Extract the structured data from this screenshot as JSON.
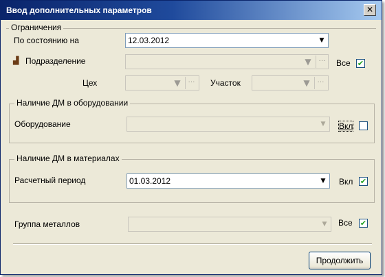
{
  "window": {
    "title": "Ввод дополнительных параметров",
    "close_glyph": "✕"
  },
  "restrictions": {
    "legend": "Ограничения",
    "as_of_label": "По состоянию на",
    "as_of_value": "12.03.2012",
    "department_label": "Подразделение",
    "department_value": "",
    "all_label": "Все",
    "all_checked": true,
    "shop_label": "Цех",
    "shop_value": "",
    "section_label": "Участок",
    "section_value": ""
  },
  "equipment_group": {
    "legend": "Наличие ДМ в оборудовании",
    "equipment_label": "Оборудование",
    "equipment_value": "",
    "include_label": "Вкл",
    "include_checked": false
  },
  "materials_group": {
    "legend": "Наличие ДМ в материалах",
    "period_label": "Расчетный период",
    "period_value": "01.03.2012",
    "include_label": "Вкл",
    "include_checked": true
  },
  "metals": {
    "group_label": "Группа металлов",
    "group_value": "",
    "all_label": "Все",
    "all_checked": true
  },
  "actions": {
    "continue_label": "Продолжить"
  },
  "glyphs": {
    "dropdown": "▼",
    "check": "✔",
    "filter": "▼",
    "dots": "···",
    "dept_icon": "▟"
  }
}
